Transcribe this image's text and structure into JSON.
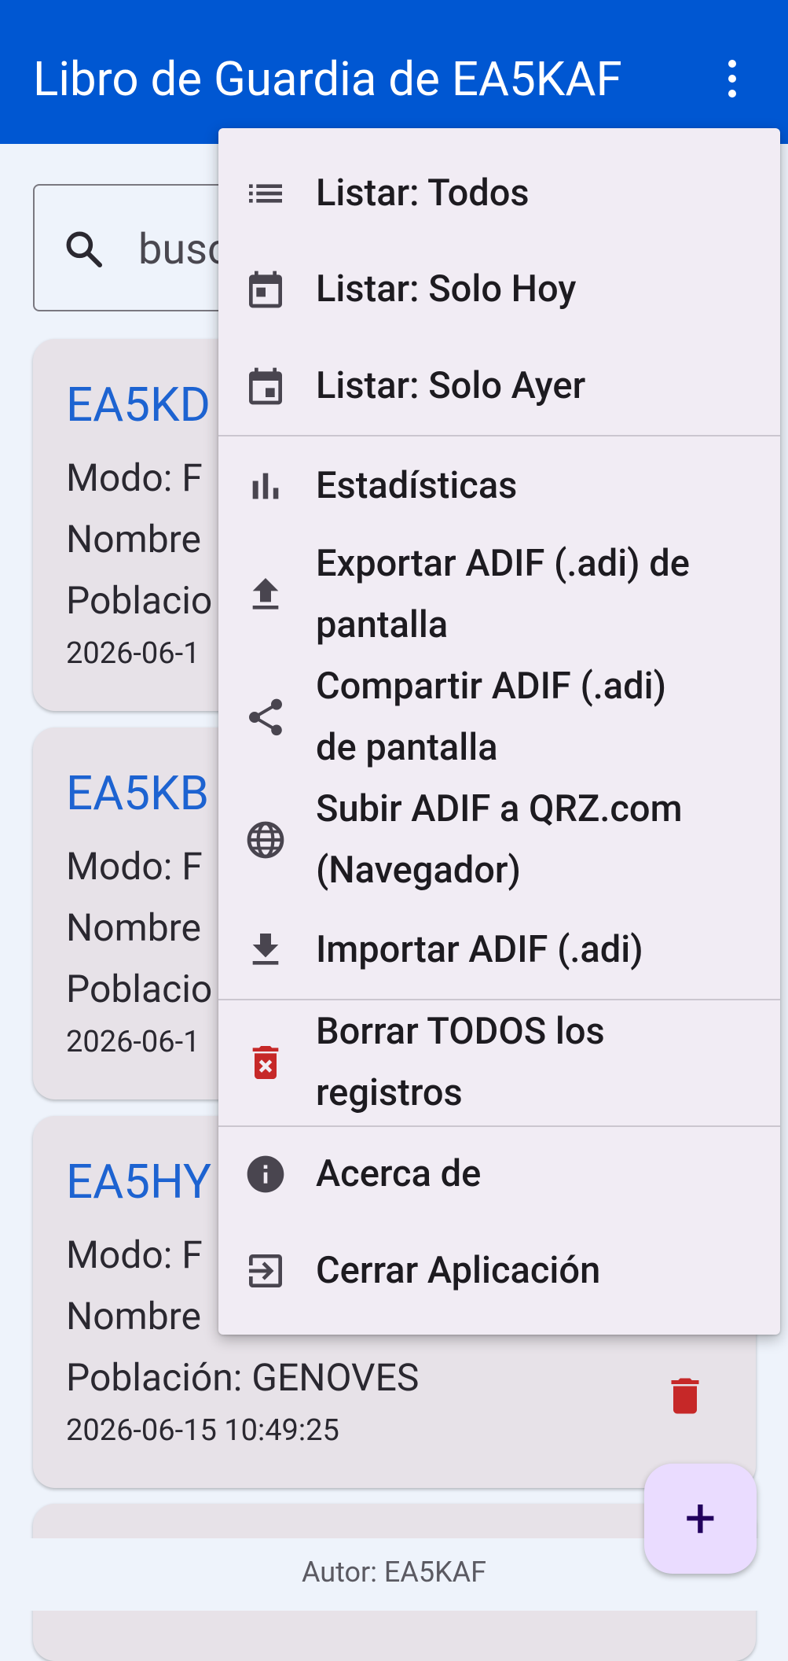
{
  "app": {
    "title": "Libro de Guardia de EA5KAF"
  },
  "search": {
    "value": "busc"
  },
  "cards": [
    {
      "callsign": "EA5KD",
      "modo": "Modo: F",
      "nombre": "Nombre",
      "poblacion": "Poblacio",
      "date": "2026-06-1"
    },
    {
      "callsign": "EA5KB",
      "modo": "Modo: F",
      "nombre": "Nombre",
      "poblacion": "Poblacio",
      "date": "2026-06-1"
    },
    {
      "callsign": "EA5HY",
      "modo": "Modo: F",
      "nombre": "Nombre",
      "poblacion": "Población: GENOVES",
      "date": "2026-06-15 10:49:25"
    }
  ],
  "menu": {
    "items": [
      {
        "label": "Listar: Todos",
        "icon": "list-icon"
      },
      {
        "label": "Listar: Solo Hoy",
        "icon": "calendar-today-icon"
      },
      {
        "label": "Listar: Solo Ayer",
        "icon": "calendar-yesterday-icon"
      },
      {
        "label": "Estadísticas",
        "icon": "bar-chart-icon"
      },
      {
        "label1": "Exportar ADIF (.adi) de",
        "label2": "pantalla",
        "icon": "upload-icon"
      },
      {
        "label1": "Compartir ADIF (.adi)",
        "label2": "de pantalla",
        "icon": "share-icon"
      },
      {
        "label1": "Subir ADIF a QRZ.com",
        "label2": "(Navegador)",
        "icon": "globe-icon"
      },
      {
        "label": "Importar ADIF (.adi)",
        "icon": "download-icon"
      },
      {
        "label1": "Borrar TODOS los",
        "label2": "registros",
        "icon": "delete-forever-icon"
      },
      {
        "label": "Acerca de",
        "icon": "info-icon"
      },
      {
        "label": "Cerrar Aplicación",
        "icon": "exit-icon"
      }
    ]
  },
  "fab": {
    "label": "+"
  },
  "footer": {
    "text": "Autor: EA5KAF"
  },
  "colors": {
    "primary": "#0057d2",
    "danger": "#c62828",
    "callsign": "#1d63d1"
  }
}
